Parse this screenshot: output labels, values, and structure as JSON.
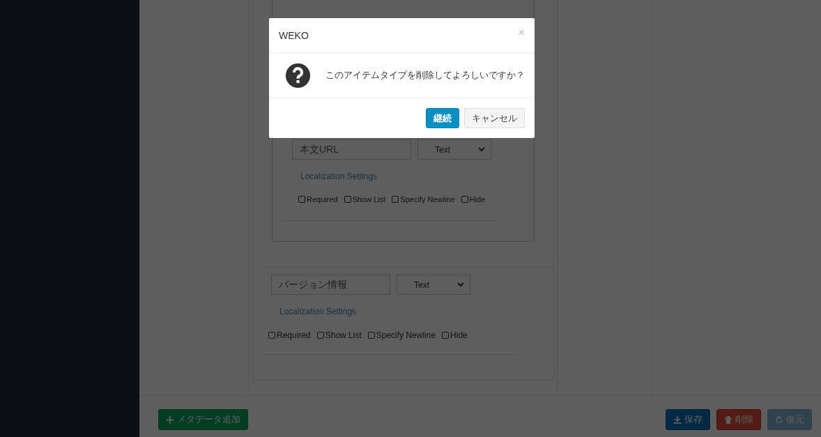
{
  "fields": [
    {
      "name": "本文URL",
      "type": "Text",
      "link": "Localization Settings",
      "options": [
        {
          "label": "Required",
          "checked": false
        },
        {
          "label": "Show List",
          "checked": false
        },
        {
          "label": "Specify Newline",
          "checked": false
        },
        {
          "label": "Hide",
          "checked": false
        }
      ],
      "nested": true
    },
    {
      "name": "バージョン情報",
      "type": "Text",
      "link": "Localization Settings",
      "options": [
        {
          "label": "Required",
          "checked": false
        },
        {
          "label": "Show List",
          "checked": false
        },
        {
          "label": "Specify Newline",
          "checked": false
        },
        {
          "label": "Hide",
          "checked": false
        }
      ],
      "nested": false
    }
  ],
  "footer": {
    "left": [
      {
        "label": "メタデータ追加",
        "kind": "add",
        "disabled": false
      }
    ],
    "right": [
      {
        "label": "保存",
        "kind": "save",
        "disabled": false
      },
      {
        "label": "削除",
        "kind": "delete",
        "disabled": false
      },
      {
        "label": "復元",
        "kind": "restore",
        "disabled": true
      }
    ]
  },
  "dialog": {
    "title": "WEKO",
    "close": "×",
    "message": "このアイテムタイプを削除してよろしいですか？",
    "buttons": [
      {
        "label": "継続",
        "kind": "primary"
      },
      {
        "label": "キャンセル",
        "kind": "default"
      }
    ]
  }
}
